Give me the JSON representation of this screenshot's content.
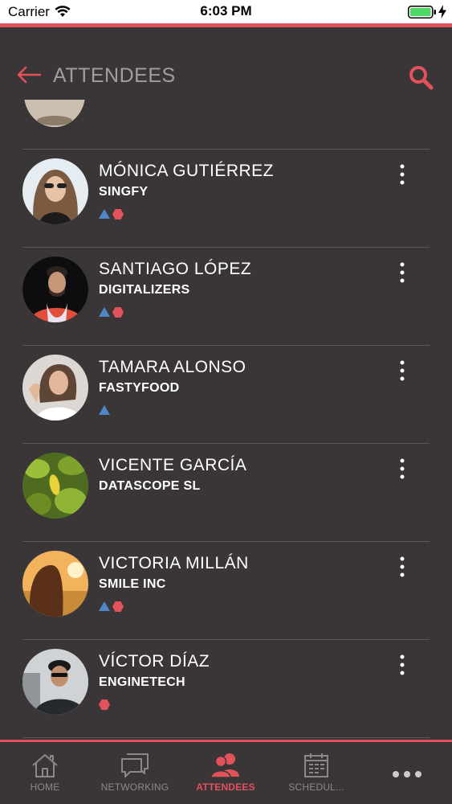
{
  "status_bar": {
    "carrier": "Carrier",
    "time": "6:03 PM"
  },
  "header": {
    "title": "ATTENDEES"
  },
  "colors": {
    "accent": "#e2525b",
    "badge_blue": "#4d87c7",
    "badge_red": "#e2525b",
    "background": "#3a3637"
  },
  "attendees": [
    {
      "name": "MÓNICA GUTIÉRREZ",
      "company": "SINGFY",
      "badges": [
        "triangle",
        "hexagon"
      ]
    },
    {
      "name": "SANTIAGO LÓPEZ",
      "company": "DIGITALIZERS",
      "badges": [
        "triangle",
        "hexagon"
      ]
    },
    {
      "name": "TAMARA ALONSO",
      "company": "FASTYFOOD",
      "badges": [
        "triangle"
      ]
    },
    {
      "name": "VICENTE GARCÍA",
      "company": "DATASCOPE SL",
      "badges": []
    },
    {
      "name": "VICTORIA MILLÁN",
      "company": "SMILE INC",
      "badges": [
        "triangle",
        "hexagon"
      ]
    },
    {
      "name": "VÍCTOR DÍAZ",
      "company": "ENGINETECH",
      "badges": [
        "hexagon"
      ]
    }
  ],
  "tabs": [
    {
      "label": "HOME",
      "icon": "home-icon",
      "active": false
    },
    {
      "label": "NETWORKING",
      "icon": "chat-icon",
      "active": false
    },
    {
      "label": "ATTENDEES",
      "icon": "people-icon",
      "active": true
    },
    {
      "label": "SCHEDUL...",
      "icon": "calendar-icon",
      "active": false
    },
    {
      "label": "",
      "icon": "more-icon",
      "active": false
    }
  ]
}
